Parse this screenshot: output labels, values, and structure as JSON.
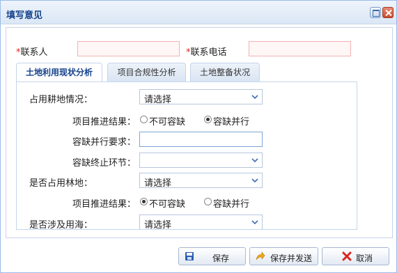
{
  "window": {
    "title": "填写意见"
  },
  "form": {
    "contact_label": "联系人",
    "phone_label": "联系电话",
    "required_mark": "*"
  },
  "tabs": [
    {
      "label": "土地利用现状分析",
      "active": true
    },
    {
      "label": "项目合规性分析",
      "active": false
    },
    {
      "label": "土地整备状况",
      "active": false
    }
  ],
  "panel": {
    "farmland_label": "占用耕地情况：",
    "farmland_value": "请选择",
    "result1_label": "项目推进结果：",
    "result1_opt1": "不可容缺",
    "result1_opt2": "容缺并行",
    "tolerance_req_label": "容缺并行要求：",
    "tolerance_end_label": "容缺终止环节：",
    "forest_label": "是否占用林地：",
    "forest_value": "请选择",
    "result2_label": "项目推进结果：",
    "result2_opt1": "不可容缺",
    "result2_opt2": "容缺并行",
    "sea_label": "是否涉及用海：",
    "sea_value": "请选择"
  },
  "buttons": {
    "save": "保存",
    "save_send": "保存并发送",
    "cancel": "取消"
  },
  "colors": {
    "accent": "#15428b",
    "required": "#e0261a",
    "cancel_icon": "#d9261c",
    "save_icon": "#2a5db0"
  }
}
